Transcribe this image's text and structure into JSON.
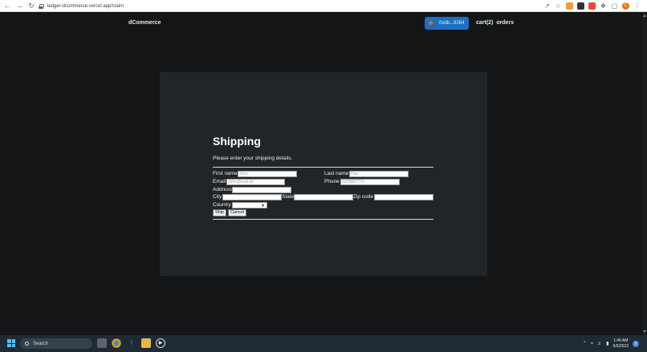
{
  "browser": {
    "url": "ledger-dcommerce.vercel.app/claim",
    "profile_initial": "C"
  },
  "header": {
    "brand": "dCommerce",
    "wallet_label": "0xdb...8264",
    "cart_label": "cart(2)",
    "orders_label": "orders"
  },
  "form": {
    "title": "Shipping",
    "subtitle": "Please enter your shipping details.",
    "first_name_label": "First name",
    "first_name_placeholder": "John",
    "last_name_label": "Last name",
    "last_name_placeholder": "Doe",
    "email_label": "Email",
    "email_placeholder": "John@mail.lol",
    "phone_label": "Phone",
    "phone_placeholder": "8208887779",
    "address_label": "Address",
    "city_label": "City",
    "state_label": "State",
    "zip_label": "Zip code",
    "country_label": "Country",
    "country_selected": "",
    "ship_label": "Ship",
    "cancel_label": "Cancel"
  },
  "taskbar": {
    "search_label": "Search",
    "time": "1:46 AM",
    "date": "6/6/2023",
    "notification_count": "5"
  }
}
